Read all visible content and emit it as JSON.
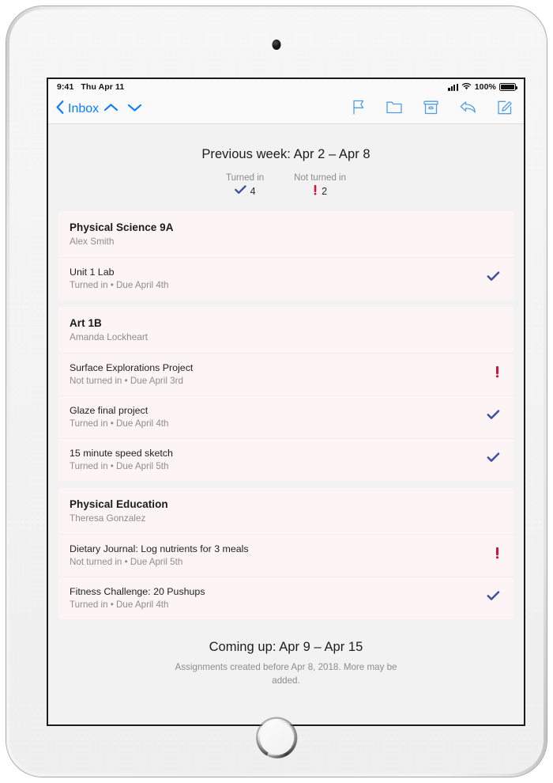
{
  "device": {
    "type": "tablet",
    "camera_icon": "front-camera-dot",
    "home_button_icon": "home-button-ring"
  },
  "status_bar": {
    "time": "9:41",
    "date": "Thu Apr 11",
    "signal_icon": "cellular-signal-icon",
    "wifi_icon": "wifi-icon",
    "battery_percent": "100%",
    "battery_icon": "battery-full-icon"
  },
  "toolbar": {
    "back_label": "Inbox",
    "back_icon": "chevron-left-icon",
    "prev_message_icon": "chevron-up-icon",
    "next_message_icon": "chevron-down-icon",
    "flag_icon": "flag-icon",
    "folder_icon": "folder-icon",
    "archive_icon": "archive-box-icon",
    "reply_icon": "reply-arrow-icon",
    "compose_icon": "compose-pencil-icon"
  },
  "summary": {
    "title": "Previous week: Apr 2 – Apr 8",
    "stats": [
      {
        "label": "Turned in",
        "value": "4",
        "icon": "checkmark-icon"
      },
      {
        "label": "Not turned in",
        "value": "2",
        "icon": "exclamation-icon"
      }
    ]
  },
  "classes": [
    {
      "name": "Physical Science 9A",
      "teacher": "Alex Smith",
      "assignments": [
        {
          "name": "Unit 1 Lab",
          "meta": "Turned in  •  Due April 4th",
          "status": "turned-in",
          "icon": "checkmark-icon"
        }
      ]
    },
    {
      "name": "Art 1B",
      "teacher": "Amanda Lockheart",
      "assignments": [
        {
          "name": "Surface Explorations Project",
          "meta": "Not turned in  •  Due April 3rd",
          "status": "not-turned-in",
          "icon": "exclamation-icon"
        },
        {
          "name": "Glaze final project",
          "meta": "Turned in  •  Due April 4th",
          "status": "turned-in",
          "icon": "checkmark-icon"
        },
        {
          "name": "15 minute speed sketch",
          "meta": "Turned in  •  Due April 5th",
          "status": "turned-in",
          "icon": "checkmark-icon"
        }
      ]
    },
    {
      "name": "Physical Education",
      "teacher": "Theresa Gonzalez",
      "assignments": [
        {
          "name": "Dietary Journal: Log nutrients for 3 meals",
          "meta": "Not turned in  •  Due April 5th",
          "status": "not-turned-in",
          "icon": "exclamation-icon"
        },
        {
          "name": "Fitness Challenge: 20 Pushups",
          "meta": "Turned in  •  Due April 4th",
          "status": "turned-in",
          "icon": "checkmark-icon"
        }
      ]
    }
  ],
  "footer": {
    "title": "Coming up: Apr 9 – Apr 15",
    "note": "Assignments created before Apr 8, 2018. More may be added."
  },
  "colors": {
    "accent_blue": "#0a7cff",
    "checkmark": "#3f4f9e",
    "exclamation": "#cc1638",
    "card_background": "#fdf5f5",
    "page_background": "#f2f2f2"
  }
}
